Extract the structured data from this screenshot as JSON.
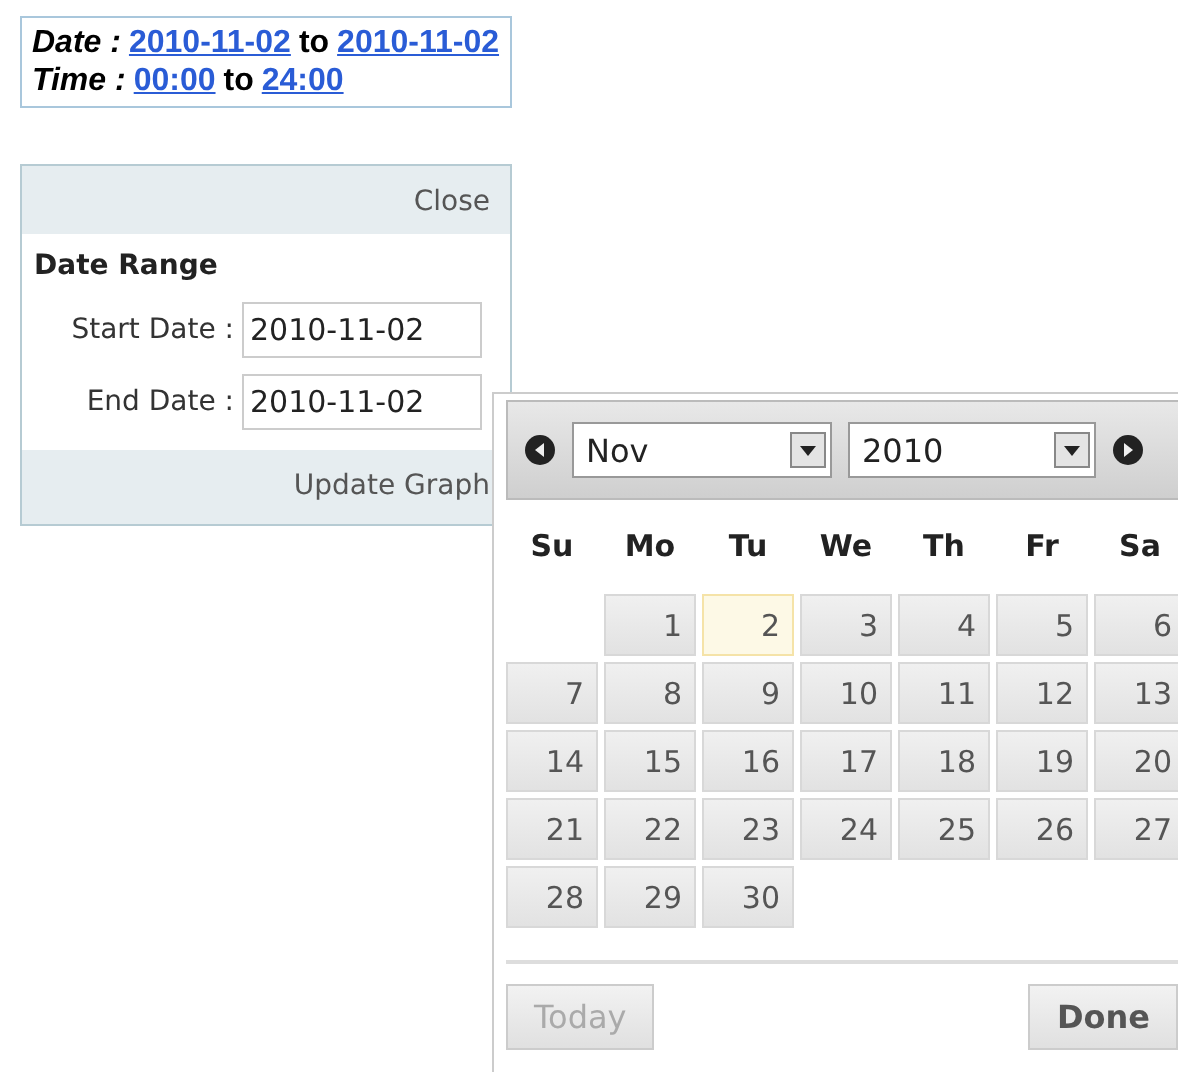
{
  "summary": {
    "lines": [
      {
        "label": "Date",
        "separator": " : ",
        "from": "2010-11-02",
        "joiner": "to",
        "to": "2010-11-02"
      },
      {
        "label": "Time",
        "separator": " : ",
        "from": "00:00",
        "joiner": "to",
        "to": "24:00"
      }
    ]
  },
  "panel": {
    "close": "Close",
    "title": "Date Range",
    "fields": [
      {
        "label": "Start Date :",
        "value": "2010-11-02"
      },
      {
        "label": "End Date :",
        "value": "2010-11-02"
      }
    ],
    "update_button": "Update Graph"
  },
  "calendar": {
    "month": "Nov",
    "year": "2010",
    "weekdays": [
      "Su",
      "Mo",
      "Tu",
      "We",
      "Th",
      "Fr",
      "Sa"
    ],
    "cells": [
      {
        "kind": "blank"
      },
      {
        "kind": "day",
        "label": "1",
        "selected": false
      },
      {
        "kind": "day",
        "label": "2",
        "selected": true
      },
      {
        "kind": "day",
        "label": "3",
        "selected": false
      },
      {
        "kind": "day",
        "label": "4",
        "selected": false
      },
      {
        "kind": "day",
        "label": "5",
        "selected": false
      },
      {
        "kind": "day",
        "label": "6",
        "selected": false
      },
      {
        "kind": "day",
        "label": "7",
        "selected": false
      },
      {
        "kind": "day",
        "label": "8",
        "selected": false
      },
      {
        "kind": "day",
        "label": "9",
        "selected": false
      },
      {
        "kind": "day",
        "label": "10",
        "selected": false
      },
      {
        "kind": "day",
        "label": "11",
        "selected": false
      },
      {
        "kind": "day",
        "label": "12",
        "selected": false
      },
      {
        "kind": "day",
        "label": "13",
        "selected": false
      },
      {
        "kind": "day",
        "label": "14",
        "selected": false
      },
      {
        "kind": "day",
        "label": "15",
        "selected": false
      },
      {
        "kind": "day",
        "label": "16",
        "selected": false
      },
      {
        "kind": "day",
        "label": "17",
        "selected": false
      },
      {
        "kind": "day",
        "label": "18",
        "selected": false
      },
      {
        "kind": "day",
        "label": "19",
        "selected": false
      },
      {
        "kind": "day",
        "label": "20",
        "selected": false
      },
      {
        "kind": "day",
        "label": "21",
        "selected": false
      },
      {
        "kind": "day",
        "label": "22",
        "selected": false
      },
      {
        "kind": "day",
        "label": "23",
        "selected": false
      },
      {
        "kind": "day",
        "label": "24",
        "selected": false
      },
      {
        "kind": "day",
        "label": "25",
        "selected": false
      },
      {
        "kind": "day",
        "label": "26",
        "selected": false
      },
      {
        "kind": "day",
        "label": "27",
        "selected": false
      },
      {
        "kind": "day",
        "label": "28",
        "selected": false
      },
      {
        "kind": "day",
        "label": "29",
        "selected": false
      },
      {
        "kind": "day",
        "label": "30",
        "selected": false
      }
    ],
    "buttons": [
      {
        "label": "Today",
        "disabled": true
      },
      {
        "label": "Done",
        "disabled": false
      }
    ]
  }
}
